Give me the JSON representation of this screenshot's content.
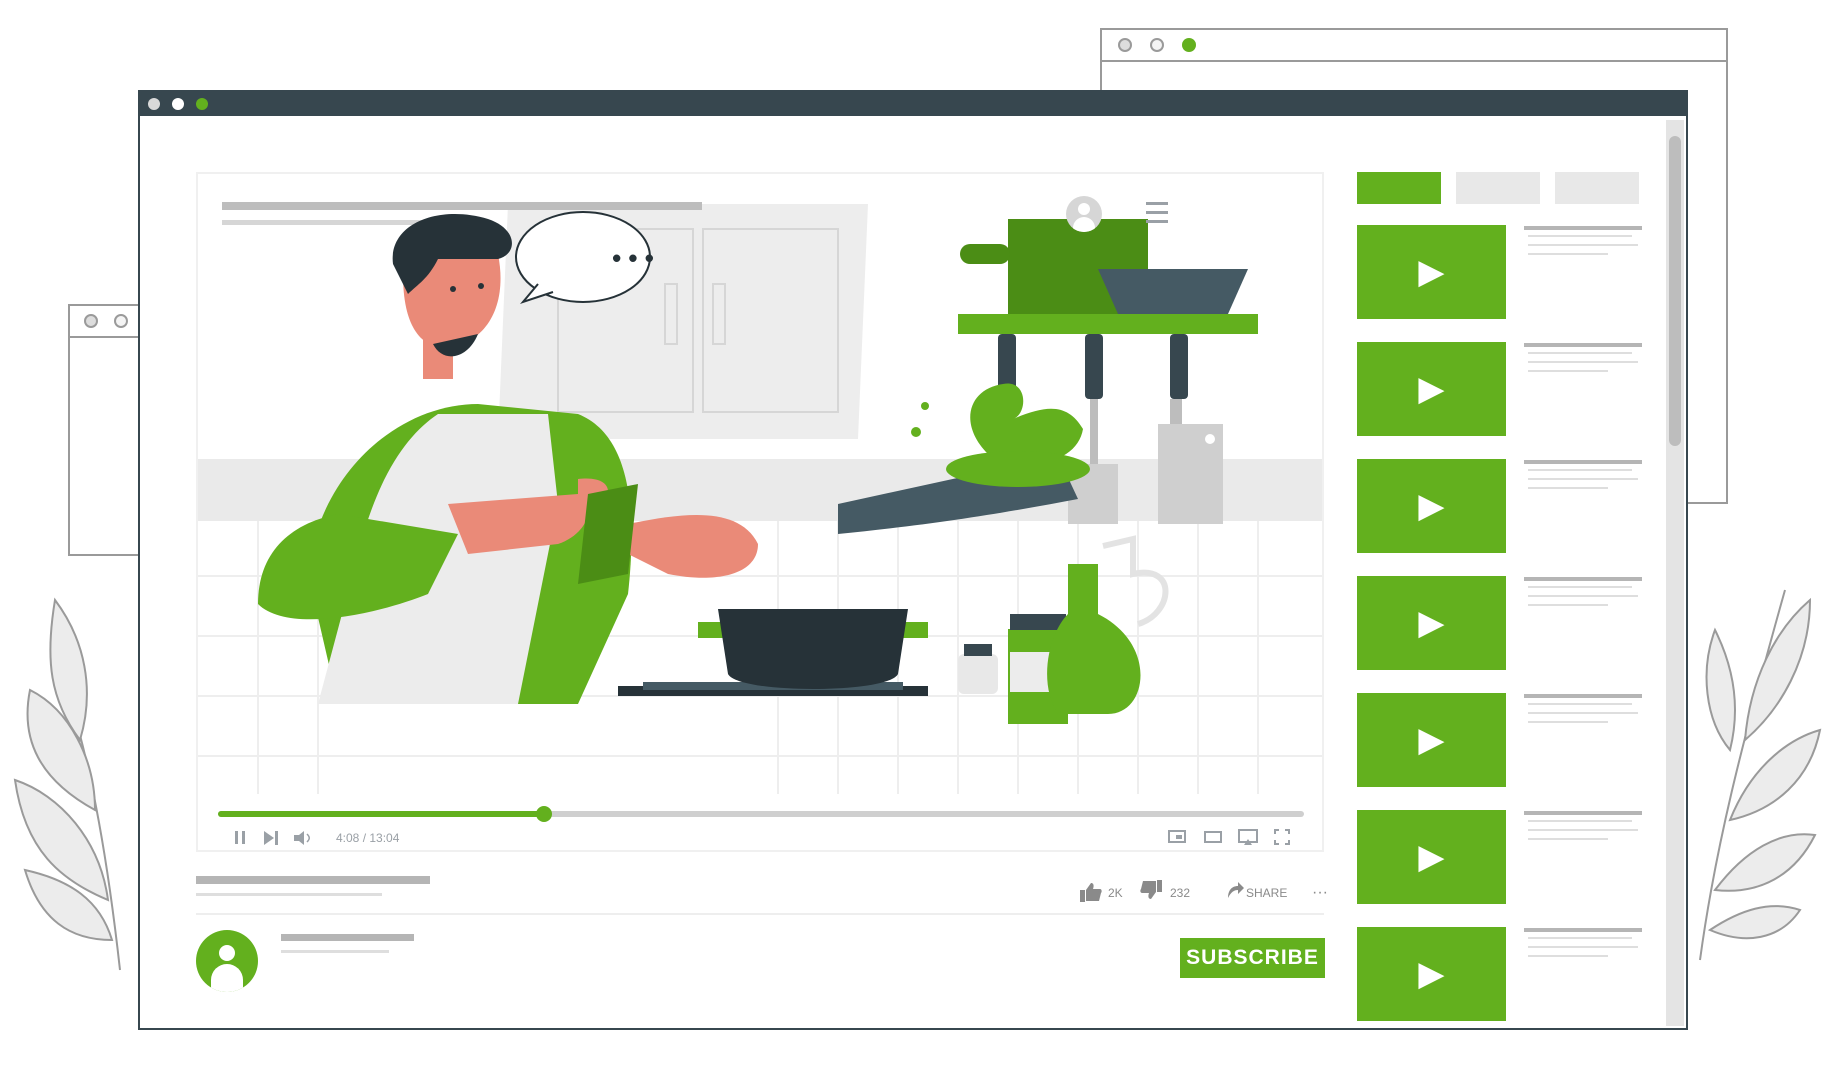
{
  "colors": {
    "accent": "#63b01e",
    "accent_dark": "#4b8d15",
    "titlebar": "#37474f",
    "skin": "#ea8a78"
  },
  "video": {
    "time": "4:08 / 13:04",
    "progress": 0.3,
    "overlay_menu_icon": "hamburger-icon",
    "overlay_avatar_icon": "user-avatar-icon",
    "speech_bubble": "• • •"
  },
  "controls": {
    "pause_icon": "pause-icon",
    "next_icon": "next-icon",
    "volume_icon": "volume-icon",
    "right_icons": [
      "miniplayer-icon",
      "theater-icon",
      "cast-icon",
      "fullscreen-icon"
    ]
  },
  "actions": {
    "likes": "2K",
    "dislikes": "232",
    "share": "SHARE",
    "more": "···"
  },
  "channel": {
    "subscribe_label": "SUBSCRIBE"
  },
  "sidebar": {
    "tabs_count": 3,
    "play_glyph": "▶",
    "videos_count": 7
  }
}
